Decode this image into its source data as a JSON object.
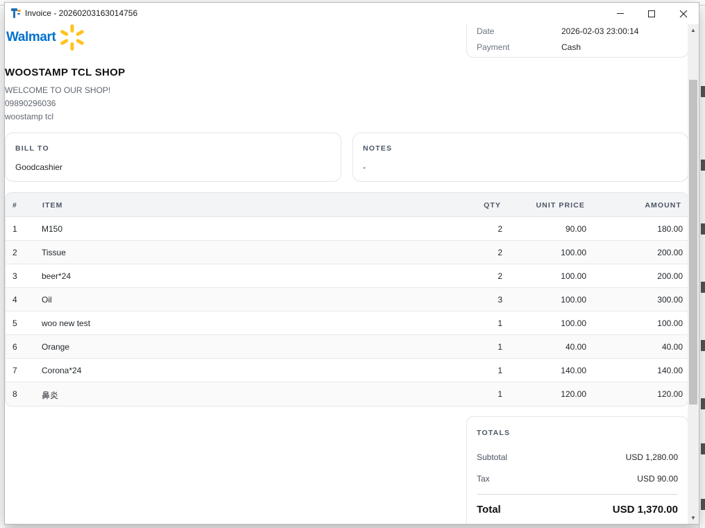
{
  "window": {
    "title": "Invoice - 20260203163014756"
  },
  "brand": {
    "logo_text": "Walmart",
    "logo_color": "#0071ce",
    "spark_color": "#ffc220"
  },
  "meta": {
    "date_label": "Date",
    "date_value": "2026-02-03 23:00:14",
    "payment_label": "Payment",
    "payment_value": "Cash"
  },
  "shop": {
    "name": "WOOSTAMP TCL SHOP",
    "welcome": "WELCOME TO OUR SHOP!",
    "phone": "09890296036",
    "address": "woostamp tcl"
  },
  "bill_to": {
    "label": "BILL TO",
    "value": "Goodcashier"
  },
  "notes": {
    "label": "NOTES",
    "value": "-"
  },
  "items": {
    "headers": [
      "#",
      "ITEM",
      "QTY",
      "UNIT PRICE",
      "AMOUNT"
    ],
    "rows": [
      {
        "no": "1",
        "item": "M150",
        "qty": "2",
        "unit_price": "90.00",
        "amount": "180.00"
      },
      {
        "no": "2",
        "item": "Tissue",
        "qty": "2",
        "unit_price": "100.00",
        "amount": "200.00"
      },
      {
        "no": "3",
        "item": "beer*24",
        "qty": "2",
        "unit_price": "100.00",
        "amount": "200.00"
      },
      {
        "no": "4",
        "item": "Oil",
        "qty": "3",
        "unit_price": "100.00",
        "amount": "300.00"
      },
      {
        "no": "5",
        "item": "woo new test",
        "qty": "1",
        "unit_price": "100.00",
        "amount": "100.00"
      },
      {
        "no": "6",
        "item": "Orange",
        "qty": "1",
        "unit_price": "40.00",
        "amount": "40.00"
      },
      {
        "no": "7",
        "item": "Corona*24",
        "qty": "1",
        "unit_price": "140.00",
        "amount": "140.00"
      },
      {
        "no": "8",
        "item": "鼻炎",
        "qty": "1",
        "unit_price": "120.00",
        "amount": "120.00"
      }
    ]
  },
  "totals": {
    "label": "TOTALS",
    "subtotal_label": "Subtotal",
    "subtotal_value": "USD 1,280.00",
    "tax_label": "Tax",
    "tax_value": "USD 90.00",
    "total_label": "Total",
    "total_value": "USD 1,370.00"
  }
}
